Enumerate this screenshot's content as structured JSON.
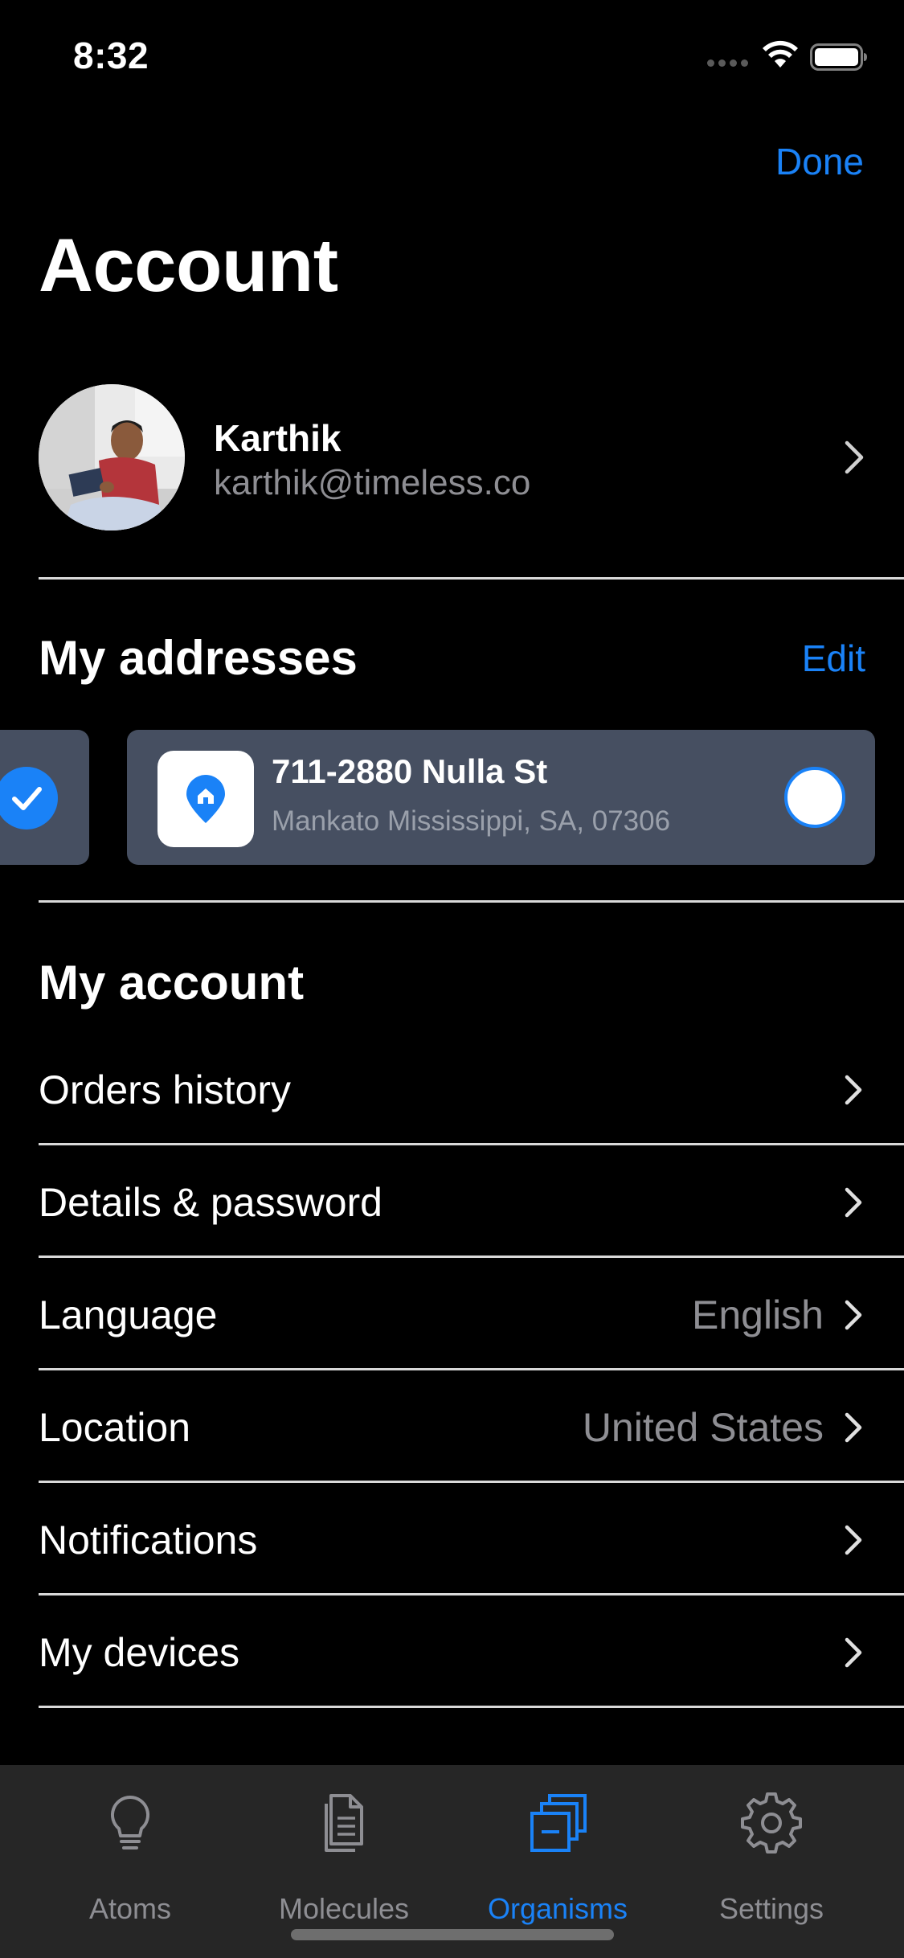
{
  "status_bar": {
    "time": "8:32",
    "icons": [
      "signal-dots-icon",
      "wifi-icon",
      "battery-icon"
    ]
  },
  "nav": {
    "done_label": "Done"
  },
  "page": {
    "title": "Account"
  },
  "profile": {
    "name": "Karthik",
    "email": "karthik@timeless.co",
    "avatar": "avatar-photo"
  },
  "addresses": {
    "title": "My addresses",
    "edit_label": "Edit",
    "items": [
      {
        "street": "711-2880 Nulla St",
        "city": "Mankato Mississippi, SA, 07306",
        "icon": "home-pin-icon",
        "selected": false
      }
    ]
  },
  "my_account": {
    "title": "My account",
    "items": [
      {
        "label": "Orders history",
        "value": ""
      },
      {
        "label": "Details & password",
        "value": ""
      },
      {
        "label": "Language",
        "value": "English"
      },
      {
        "label": "Location",
        "value": "United States"
      },
      {
        "label": "Notifications",
        "value": ""
      },
      {
        "label": "My devices",
        "value": ""
      }
    ]
  },
  "tab_bar": {
    "tabs": [
      {
        "label": "Atoms",
        "icon": "lightbulb-icon",
        "active": false
      },
      {
        "label": "Molecules",
        "icon": "document-icon",
        "active": false
      },
      {
        "label": "Organisms",
        "icon": "stacked-cards-icon",
        "active": true
      },
      {
        "label": "Settings",
        "icon": "gear-icon",
        "active": false
      }
    ]
  },
  "colors": {
    "background": "#000000",
    "accent": "#1a82f7",
    "card": "#464f61",
    "secondary_text": "#8e8e93",
    "tab_bar": "#262626"
  }
}
